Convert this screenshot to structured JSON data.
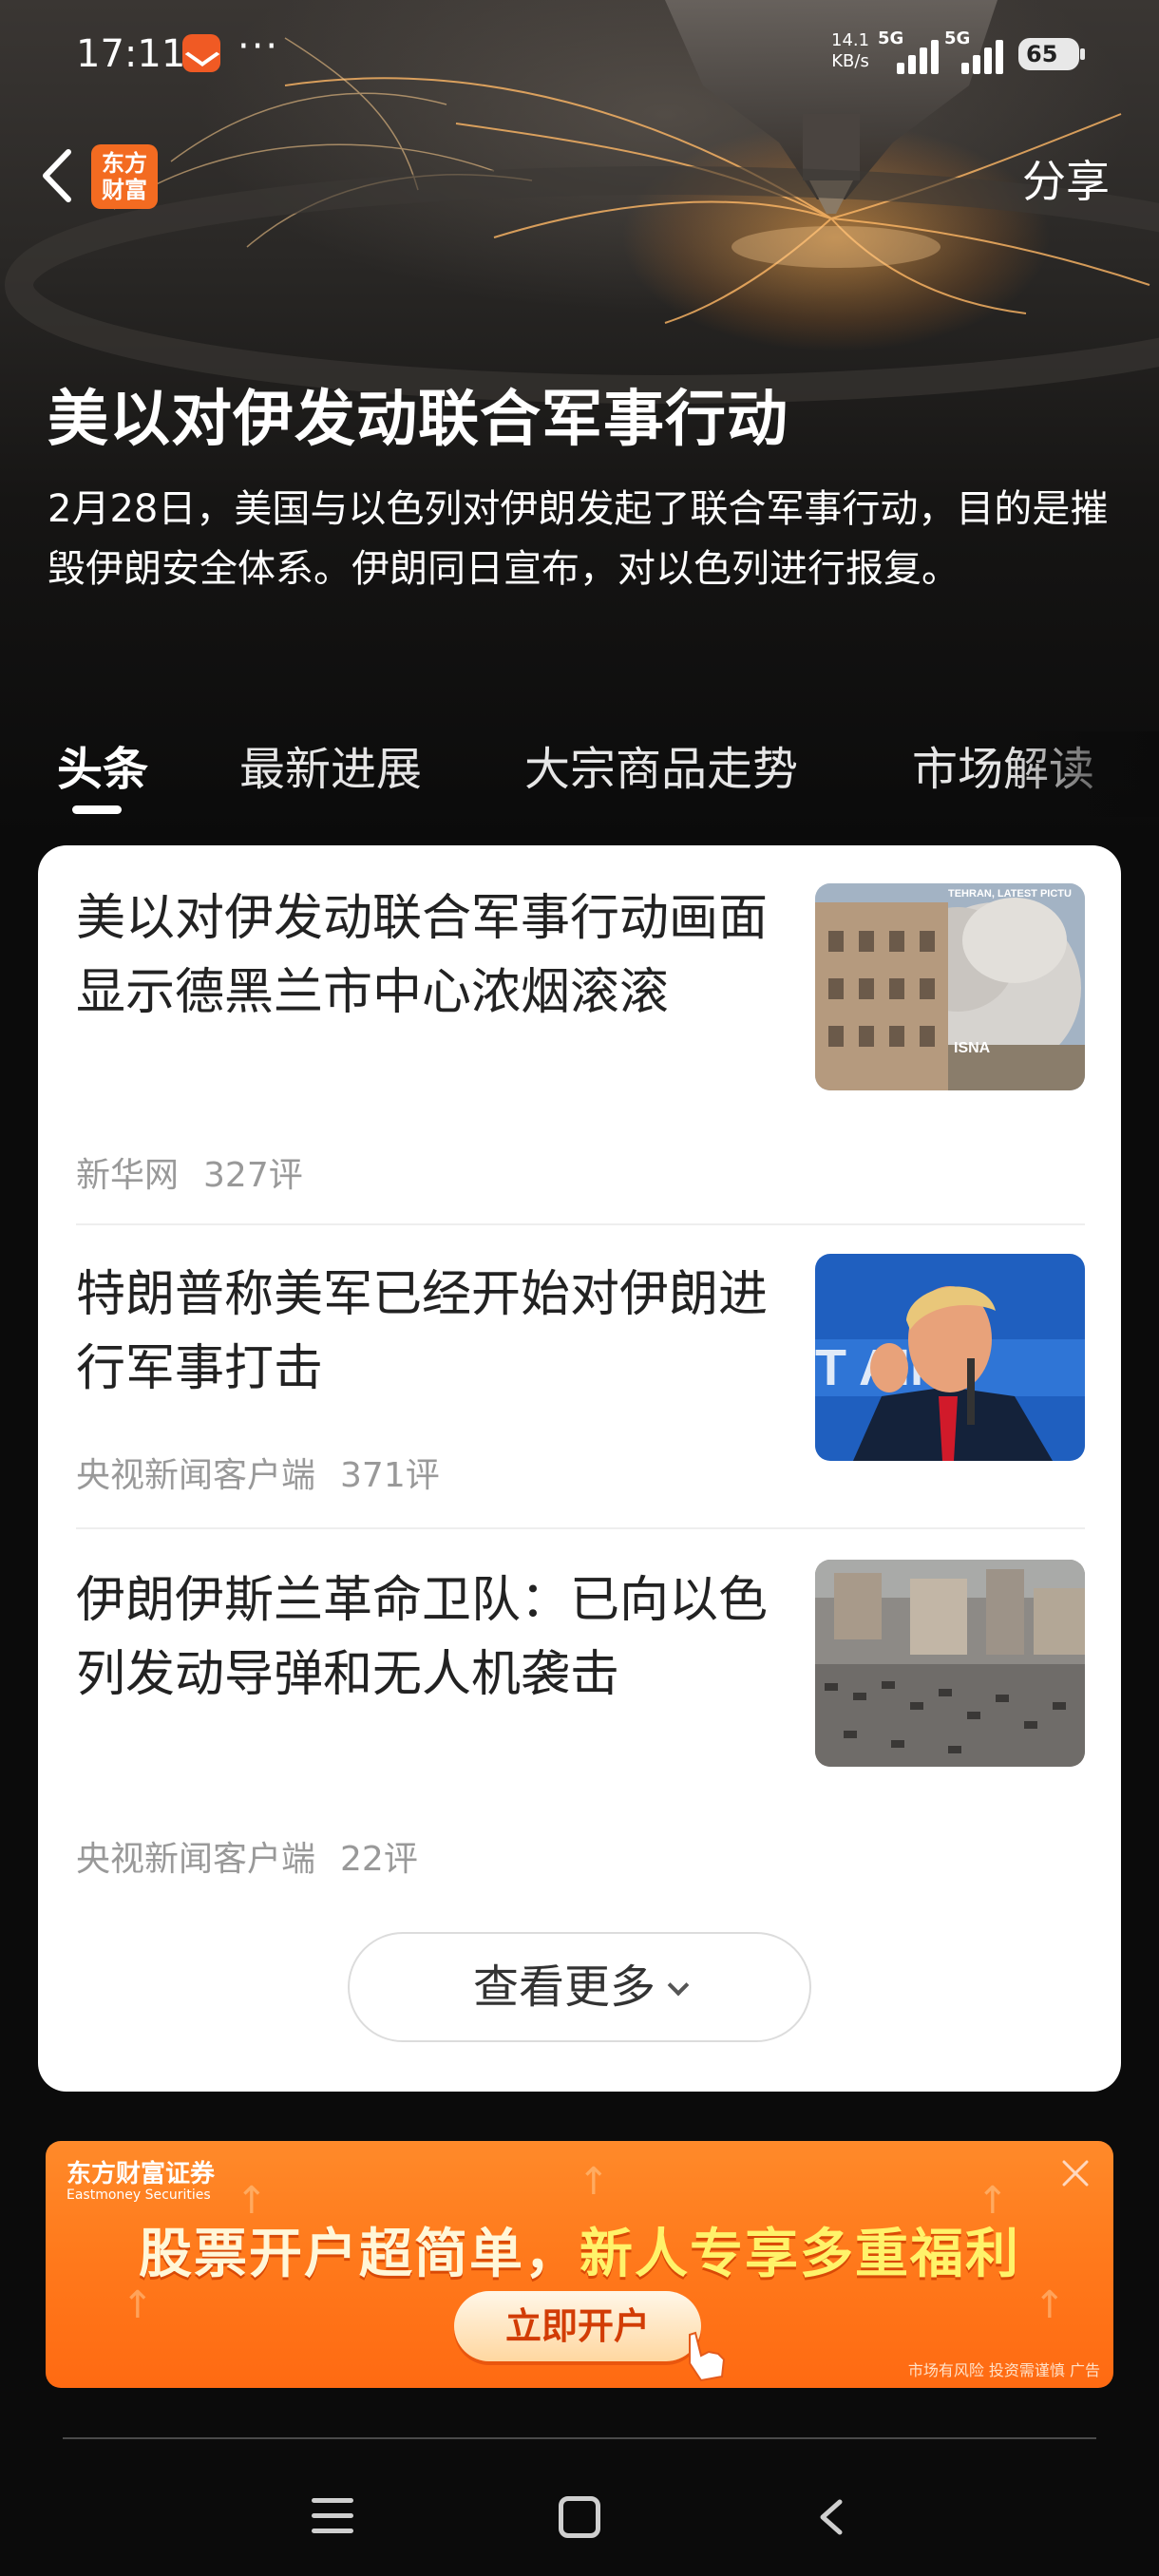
{
  "status_bar": {
    "time": "17:11",
    "more": "···",
    "net_speed_value": "14.1",
    "net_speed_unit": "KB/s",
    "sim1": "5G",
    "sim2": "5G",
    "battery": "65"
  },
  "nav": {
    "logo_text": "东方\n财富",
    "share_label": "分享"
  },
  "topic": {
    "title": "美以对伊发动联合军事行动",
    "description": "2月28日，美国与以色列对伊朗发起了联合军事行动，目的是摧毁伊朗安全体系。伊朗同日宣布，对以色列进行报复。"
  },
  "tabs": [
    {
      "label": "头条",
      "active": true
    },
    {
      "label": "最新进展",
      "active": false
    },
    {
      "label": "大宗商品走势",
      "active": false
    },
    {
      "label": "市场解读",
      "active": false
    }
  ],
  "news": [
    {
      "title": "美以对伊发动联合军事行动画面显示德黑兰市中心浓烟滚滚",
      "source": "新华网",
      "comments": "327评",
      "thumb_caption": "TEHRAN, LATEST PICTU",
      "thumb_watermark": "ISNA"
    },
    {
      "title": "特朗普称美军已经开始对伊朗进行军事打击",
      "source": "央视新闻客户端",
      "comments": "371评"
    },
    {
      "title": "伊朗伊斯兰革命卫队：已向以色列发动导弹和无人机袭击",
      "source": "央视新闻客户端",
      "comments": "22评"
    }
  ],
  "more_button": "查看更多",
  "ad": {
    "brand": "东方财富证券",
    "brand_en": "Eastmoney Securities",
    "headline_part1": "股票开户超简单，",
    "headline_part2": "新人专享多重福利",
    "cta": "立即开户",
    "disclaimer": "市场有风险 投资需谨慎 广告"
  },
  "colors": {
    "brand_orange": "#f36b21",
    "card_bg": "#ffffff",
    "page_bg": "#0b0b0b",
    "meta_gray": "#999999"
  },
  "icons": [
    "back-chevron-icon",
    "menu-icon",
    "home-icon",
    "back-icon",
    "close-icon",
    "chevron-down-icon"
  ]
}
